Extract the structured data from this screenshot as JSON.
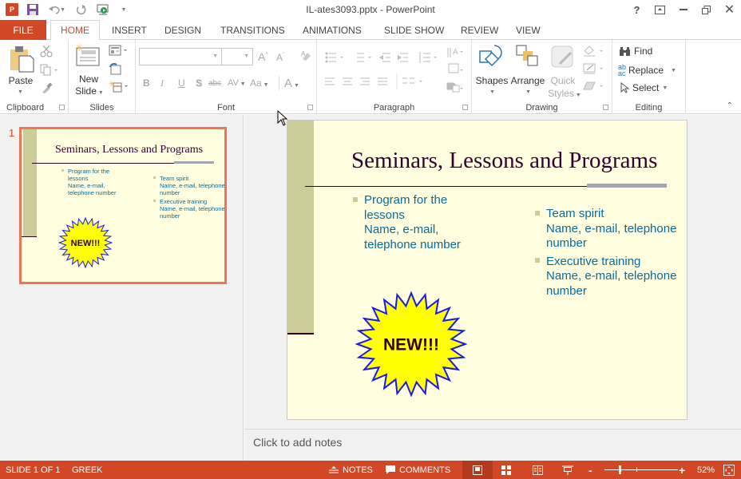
{
  "window": {
    "title": "IL-ates3093.pptx - PowerPoint",
    "controls": [
      "help",
      "ribbon-display-options",
      "minimize",
      "restore",
      "close"
    ]
  },
  "qat": {
    "icons": [
      "powerpoint-logo-icon",
      "save-icon",
      "undo-icon",
      "redo-icon",
      "start-from-beginning-icon",
      "customize-qat-icon"
    ]
  },
  "tabs": [
    {
      "label": "FILE"
    },
    {
      "label": "HOME",
      "active": true
    },
    {
      "label": "INSERT"
    },
    {
      "label": "DESIGN"
    },
    {
      "label": "TRANSITIONS"
    },
    {
      "label": "ANIMATIONS"
    },
    {
      "label": "SLIDE SHOW"
    },
    {
      "label": "REVIEW"
    },
    {
      "label": "VIEW"
    }
  ],
  "ribbon": {
    "clipboard": {
      "label": "Clipboard",
      "paste": "Paste"
    },
    "slides": {
      "label": "Slides",
      "new_slide_line1": "New",
      "new_slide_line2": "Slide"
    },
    "font": {
      "label": "Font",
      "font_name": "",
      "font_size": "",
      "bold": "B",
      "italic": "I",
      "underline": "U",
      "shadow": "S",
      "strike": "abc",
      "spacing": "AV",
      "case": "Aa",
      "color": "A"
    },
    "paragraph": {
      "label": "Paragraph"
    },
    "drawing": {
      "label": "Drawing",
      "shapes": "Shapes",
      "arrange": "Arrange",
      "quick_styles_line1": "Quick",
      "quick_styles_line2": "Styles"
    },
    "editing": {
      "label": "Editing",
      "find": "Find",
      "replace": "Replace",
      "select": "Select"
    }
  },
  "thumbnails": [
    {
      "number": "1",
      "selected": true
    }
  ],
  "slide": {
    "title": "Seminars, Lessons and Programs",
    "left_bullets": [
      {
        "lines": [
          "Program for the",
          "lessons",
          "Name, e-mail,",
          "telephone number"
        ]
      }
    ],
    "right_bullets": [
      {
        "lines": [
          "Team spirit",
          "Name, e-mail, telephone",
          "number"
        ]
      },
      {
        "lines": [
          "Executive training",
          "Name, e-mail, telephone",
          "number"
        ]
      }
    ],
    "starburst_text": "NEW!!!",
    "colors": {
      "background": "#ffffdf",
      "side_bar": "#cccc99",
      "title": "#330033",
      "body_text": "#0b6a9b",
      "starburst_fill": "#ffff00",
      "starburst_stroke": "#1a1aee"
    }
  },
  "notes": {
    "placeholder": "Click to add notes"
  },
  "status": {
    "slide_info": "SLIDE 1 OF 1",
    "language": "GREEK",
    "notes": "NOTES",
    "comments": "COMMENTS",
    "zoom_level": "52%",
    "zoom_fraction": 0.52
  },
  "accent": "#d24726"
}
